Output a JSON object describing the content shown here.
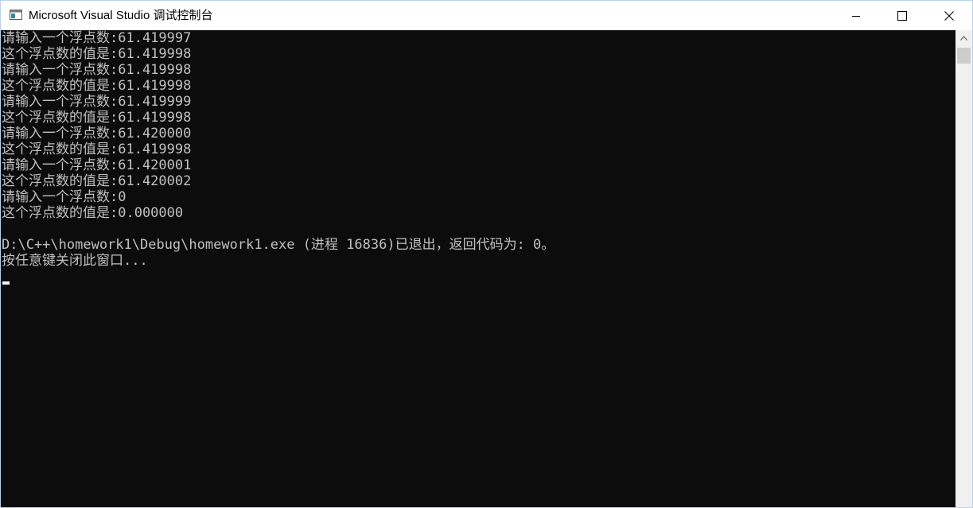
{
  "window": {
    "title": "Microsoft Visual Studio 调试控制台",
    "icon": "console-app-icon"
  },
  "caption_buttons": {
    "minimize": "minimize-icon",
    "maximize": "maximize-icon",
    "close": "close-icon"
  },
  "console": {
    "lines": [
      "请输入一个浮点数:61.419997",
      "这个浮点数的值是:61.419998",
      "请输入一个浮点数:61.419998",
      "这个浮点数的值是:61.419998",
      "请输入一个浮点数:61.419999",
      "这个浮点数的值是:61.419998",
      "请输入一个浮点数:61.420000",
      "这个浮点数的值是:61.419998",
      "请输入一个浮点数:61.420001",
      "这个浮点数的值是:61.420002",
      "请输入一个浮点数:0",
      "这个浮点数的值是:0.000000",
      "",
      "D:\\C++\\homework1\\Debug\\homework1.exe (进程 16836)已退出，返回代码为: 0。",
      "按任意键关闭此窗口..."
    ],
    "background_color": "#0c0c0c",
    "text_color": "#c0c0c0"
  },
  "scrollbar": {
    "up_arrow": "chevron-up-icon"
  }
}
